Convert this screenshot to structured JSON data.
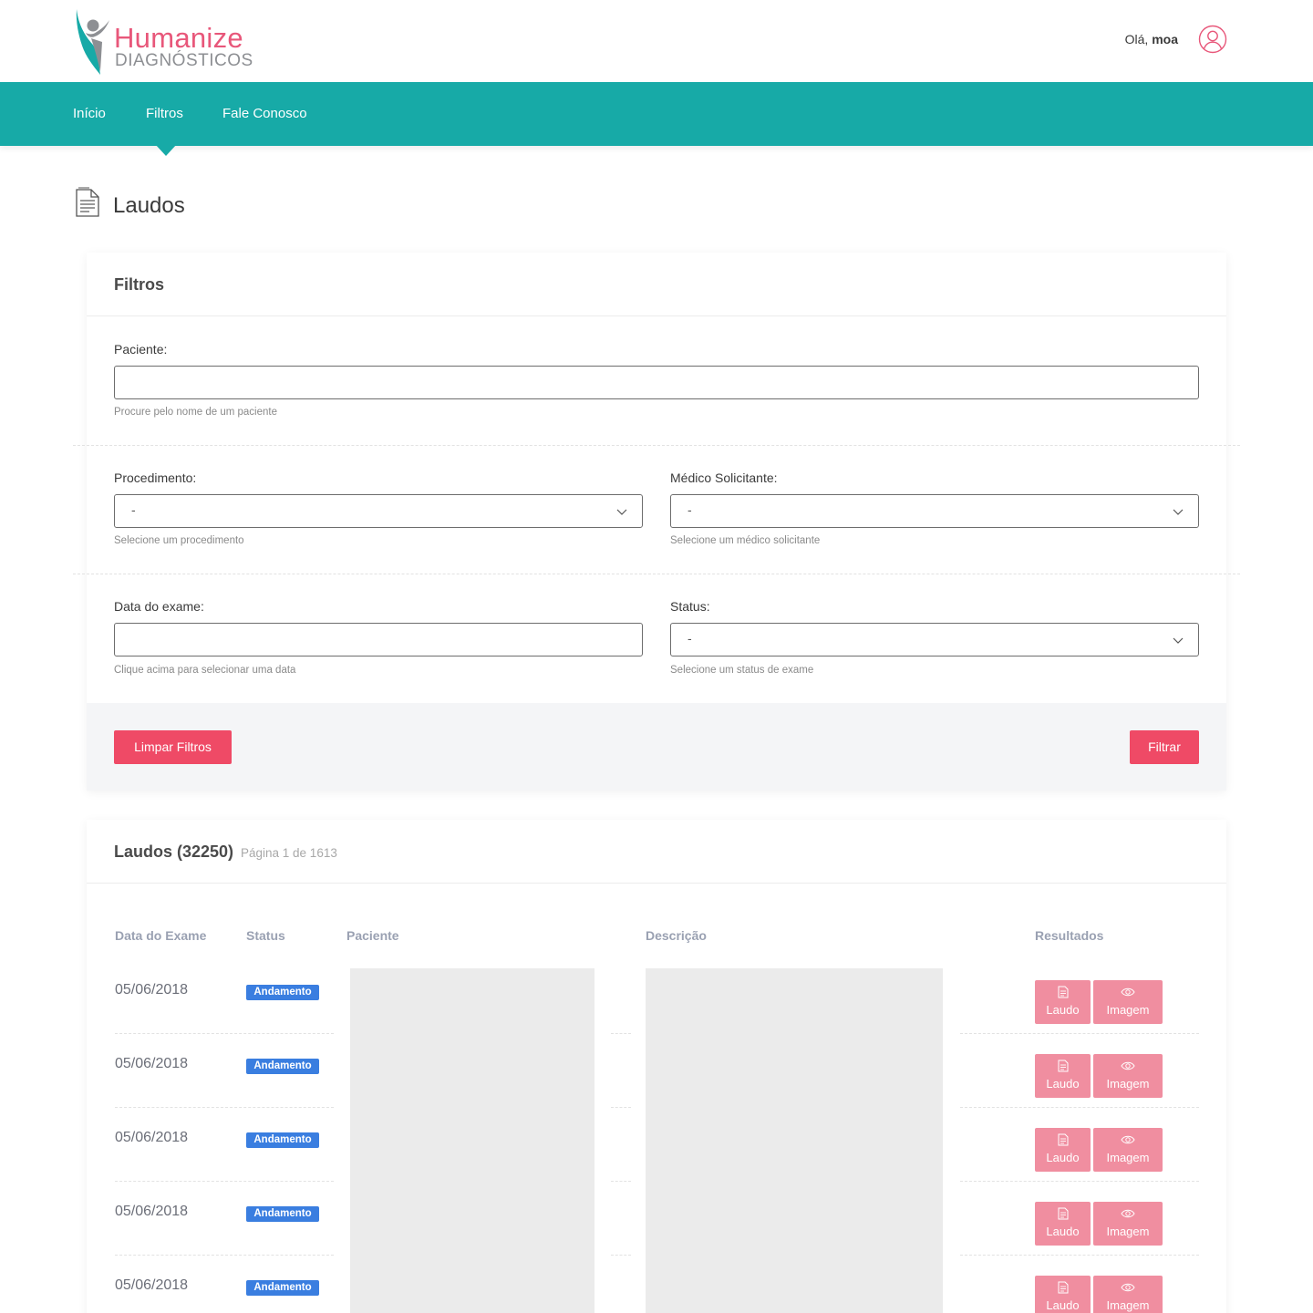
{
  "header": {
    "logo_main": "Humanize",
    "logo_sub": "DIAGNÓSTICOS",
    "greeting_prefix": "Olá,",
    "user_name": "moa"
  },
  "nav": {
    "items": [
      "Início",
      "Filtros",
      "Fale Conosco"
    ]
  },
  "page": {
    "title": "Laudos"
  },
  "filters": {
    "title": "Filtros",
    "paciente": {
      "label": "Paciente:",
      "value": "",
      "hint": "Procure pelo nome de um paciente"
    },
    "procedimento": {
      "label": "Procedimento:",
      "value": "-",
      "hint": "Selecione um procedimento"
    },
    "medico": {
      "label": "Médico Solicitante:",
      "value": "-",
      "hint": "Selecione um médico solicitante"
    },
    "data": {
      "label": "Data do exame:",
      "value": "",
      "hint": "Clique acima para selecionar uma data"
    },
    "status": {
      "label": "Status:",
      "value": "-",
      "hint": "Selecione um status de exame"
    },
    "clear_label": "Limpar Filtros",
    "filter_label": "Filtrar"
  },
  "results": {
    "title": "Laudos (32250)",
    "page_info": "Página 1 de 1613",
    "columns": [
      "Data do Exame",
      "Status",
      "Paciente",
      "Descrição",
      "Resultados"
    ],
    "rows": [
      {
        "date": "05/06/2018",
        "status": "Andamento"
      },
      {
        "date": "05/06/2018",
        "status": "Andamento"
      },
      {
        "date": "05/06/2018",
        "status": "Andamento"
      },
      {
        "date": "05/06/2018",
        "status": "Andamento"
      },
      {
        "date": "05/06/2018",
        "status": "Andamento"
      }
    ],
    "laudo_label": "Laudo",
    "imagem_label": "Imagem"
  },
  "colors": {
    "brand_teal": "#17aaa7",
    "brand_pink": "#e8577a",
    "button_red": "#ef4a66",
    "badge_blue": "#3a7ee0",
    "result_btn": "#f08ea0"
  }
}
